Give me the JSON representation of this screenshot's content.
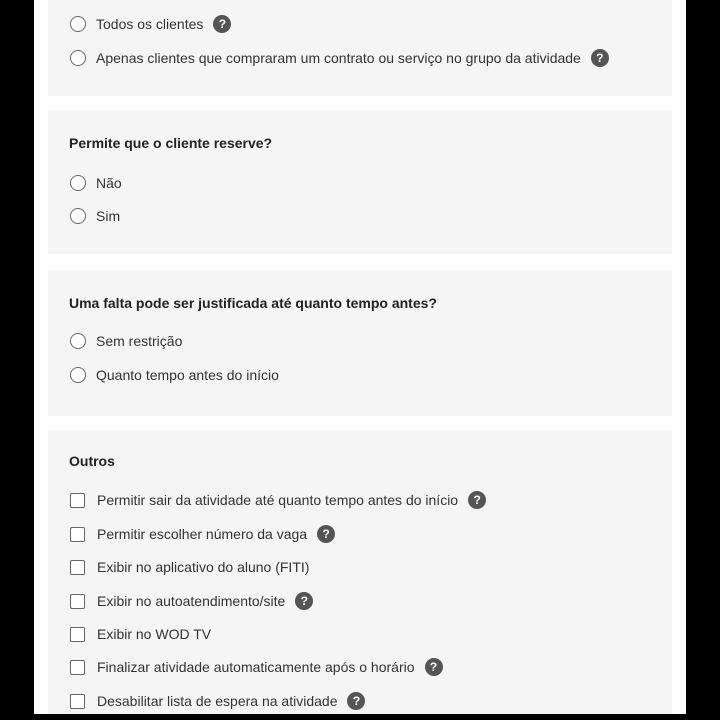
{
  "client_scope": {
    "options": [
      {
        "label": "Todos os clientes",
        "help_icon": "question-circle-icon"
      },
      {
        "label": "Apenas clientes que compraram um contrato ou serviço no grupo da atividade",
        "help_icon": "question-circle-icon"
      }
    ]
  },
  "reserve": {
    "title": "Permite que o cliente reserve?",
    "options": [
      {
        "label": "Não"
      },
      {
        "label": "Sim"
      }
    ]
  },
  "justify": {
    "title": "Uma falta pode ser justificada até quanto tempo antes?",
    "options": [
      {
        "label": "Sem restrição"
      },
      {
        "label": "Quanto tempo antes do início"
      }
    ]
  },
  "outros": {
    "title": "Outros",
    "options": [
      {
        "label": "Permitir sair da atividade até quanto tempo antes do início",
        "help": true
      },
      {
        "label": "Permitir escolher número da vaga",
        "help": true
      },
      {
        "label": "Exibir no aplicativo do aluno (FITI)",
        "help": false
      },
      {
        "label": "Exibir no autoatendimento/site",
        "help": true
      },
      {
        "label": "Exibir no WOD TV",
        "help": false
      },
      {
        "label": "Finalizar atividade automaticamente após o horário",
        "help": true
      },
      {
        "label": "Desabilitar lista de espera na atividade",
        "help": true
      }
    ]
  },
  "help_glyph": "?",
  "colors": {
    "card_bg": "#f5f5f5",
    "help_icon_bg": "#555555",
    "backdrop": "#000000"
  }
}
